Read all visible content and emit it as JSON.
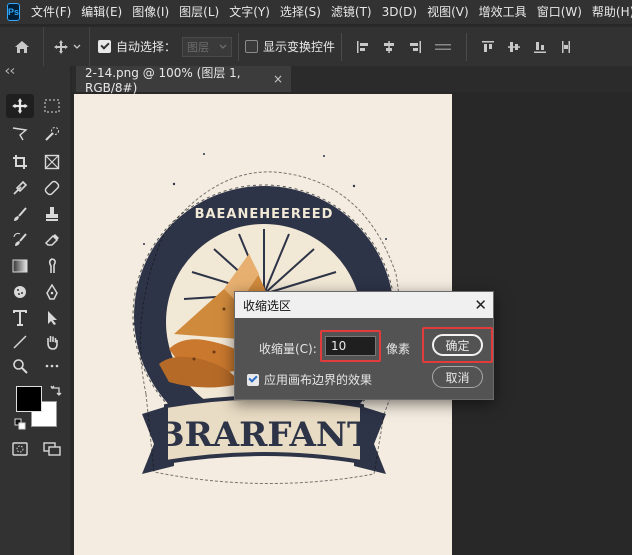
{
  "app": {
    "logo": "Ps"
  },
  "menu": [
    "文件(F)",
    "编辑(E)",
    "图像(I)",
    "图层(L)",
    "文字(Y)",
    "选择(S)",
    "滤镜(T)",
    "3D(D)",
    "视图(V)",
    "增效工具",
    "窗口(W)",
    "帮助(H)"
  ],
  "options": {
    "auto_select_label": "自动选择：",
    "auto_select_value": "图层",
    "show_transform_label": "显示变换控件"
  },
  "document": {
    "tab_title": "2-14.png @ 100% (图层 1, RGB/8#)",
    "close": "×",
    "logo_text": "BRARFANT",
    "logo_arc_text": "BAEANEHEEREED"
  },
  "dialog": {
    "title": "收缩选区",
    "close": "✕",
    "contract_label": "收缩量(C):",
    "contract_value": "10",
    "unit": "像素",
    "ok_label": "确定",
    "cancel_label": "取消",
    "apply_canvas_bounds_label": "应用画布边界的效果",
    "apply_canvas_bounds_checked": true
  },
  "colors": {
    "foreground": "#000000",
    "background": "#ffffff",
    "highlight": "#e23b3b"
  }
}
